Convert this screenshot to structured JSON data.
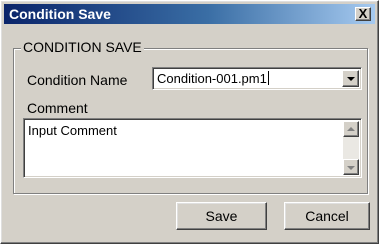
{
  "window": {
    "title": "Condition Save",
    "close_label": "X"
  },
  "group": {
    "legend": "CONDITION SAVE"
  },
  "condition_name": {
    "label": "Condition Name",
    "value": "Condition-001.pm1"
  },
  "comment": {
    "label": "Comment",
    "value": "Input Comment"
  },
  "buttons": {
    "save": "Save",
    "cancel": "Cancel"
  },
  "icons": {
    "close": "close-icon",
    "dropdown": "chevron-down-icon",
    "scroll_up": "arrow-up-icon",
    "scroll_down": "arrow-down-icon"
  }
}
